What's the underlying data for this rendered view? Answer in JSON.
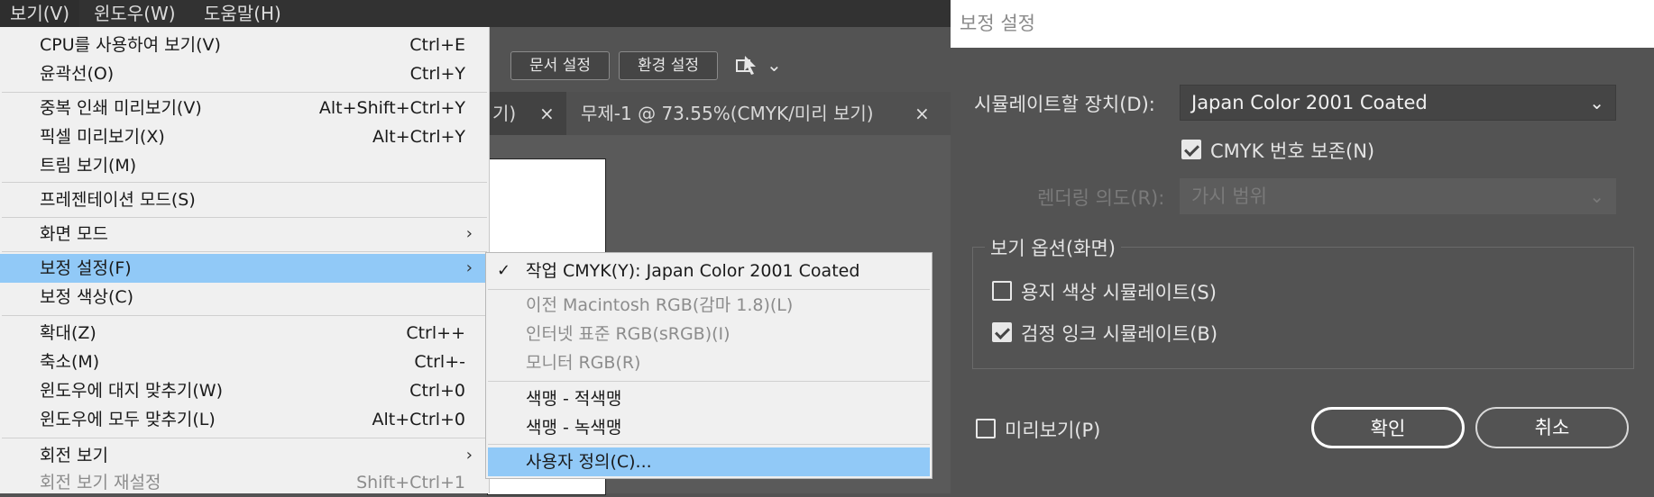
{
  "menubar": [
    "보기(V)",
    "윈도우(W)",
    "도움말(H)"
  ],
  "toolbar": {
    "doc_setup": "문서 설정",
    "preferences": "환경 설정"
  },
  "tabs": [
    {
      "label": "기)",
      "close": "×"
    },
    {
      "label": "무제-1 @ 73.55%(CMYK/미리 보기)",
      "close": "×"
    }
  ],
  "view_menu": [
    {
      "label": "CPU를 사용하여 보기(V)",
      "shortcut": "Ctrl+E"
    },
    {
      "label": "윤곽선(O)",
      "shortcut": "Ctrl+Y"
    },
    {
      "label": "중복 인쇄 미리보기(V)",
      "shortcut": "Alt+Shift+Ctrl+Y"
    },
    {
      "label": "픽셀 미리보기(X)",
      "shortcut": "Alt+Ctrl+Y"
    },
    {
      "label": "트림 보기(M)",
      "shortcut": ""
    },
    {
      "label": "프레젠테이션 모드(S)",
      "shortcut": ""
    },
    {
      "label": "화면 모드",
      "shortcut": "",
      "submenu": true
    },
    {
      "label": "보정 설정(F)",
      "shortcut": "",
      "submenu": true,
      "highlighted": true
    },
    {
      "label": "보정 색상(C)",
      "shortcut": ""
    },
    {
      "label": "확대(Z)",
      "shortcut": "Ctrl++"
    },
    {
      "label": "축소(M)",
      "shortcut": "Ctrl+-"
    },
    {
      "label": "윈도우에 대지 맞추기(W)",
      "shortcut": "Ctrl+0"
    },
    {
      "label": "윈도우에 모두 맞추기(L)",
      "shortcut": "Alt+Ctrl+0"
    },
    {
      "label": "회전 보기",
      "shortcut": "",
      "submenu": true
    },
    {
      "label": "회전 보기 재설정",
      "shortcut": "Shift+Ctrl+1",
      "disabled": true
    }
  ],
  "proof_submenu": [
    {
      "label": "작업 CMYK(Y): Japan Color 2001 Coated",
      "checked": true
    },
    {
      "label": "이전 Macintosh RGB(감마 1.8)(L)",
      "disabled": true
    },
    {
      "label": "인터넷 표준 RGB(sRGB)(I)",
      "disabled": true
    },
    {
      "label": "모니터 RGB(R)",
      "disabled": true
    },
    {
      "label": "색맹 - 적색맹"
    },
    {
      "label": "색맹 - 녹색맹"
    },
    {
      "label": "사용자 정의(C)...",
      "highlighted": true
    }
  ],
  "icons": {
    "check": "✓",
    "arrow": "›",
    "chevron": "⌄",
    "close": "×"
  },
  "dialog": {
    "title": "보정 설정",
    "device_label": "시뮬레이트할 장치(D):",
    "device_value": "Japan Color 2001 Coated",
    "preserve_cmyk": {
      "label": "CMYK 번호 보존(N)",
      "checked": true
    },
    "intent_label": "렌더링 의도(R):",
    "intent_value": "가시 범위",
    "display_options": "보기 옵션(화면)",
    "simulate_paper": {
      "label": "용지 색상 시뮬레이트(S)",
      "checked": false
    },
    "simulate_ink": {
      "label": "검정 잉크 시뮬레이트(B)",
      "checked": true
    },
    "preview": {
      "label": "미리보기(P)",
      "checked": false
    },
    "ok": "확인",
    "cancel": "취소"
  },
  "colors": {
    "highlight": "#91c9f7",
    "menu_bg": "#f0f0f0",
    "panel_bg": "#535353"
  }
}
